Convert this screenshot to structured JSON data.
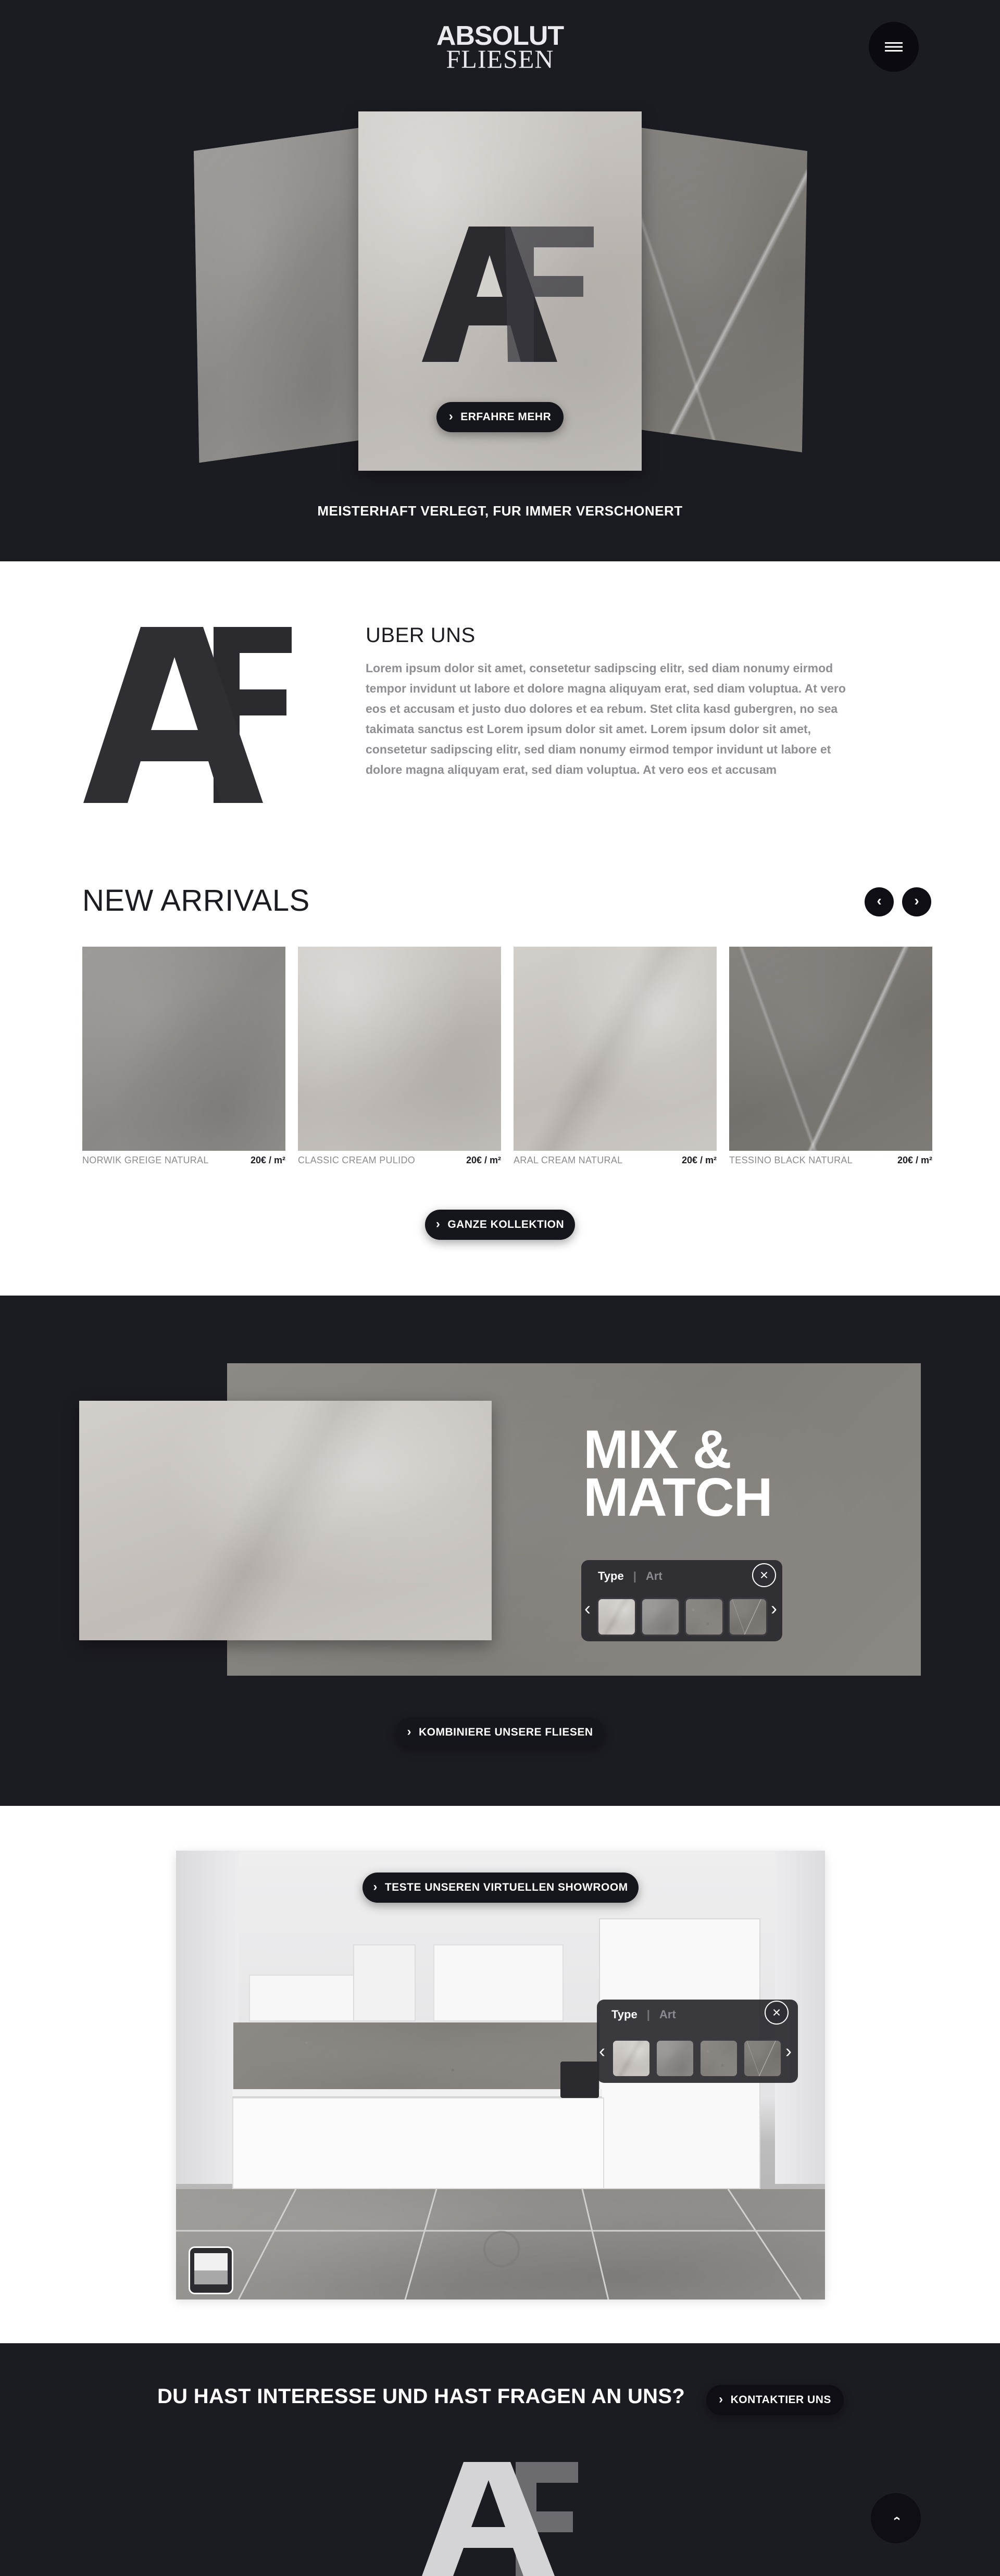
{
  "header": {
    "logo_line1": "ABSOLUT",
    "logo_line2": "FLIESEN",
    "menu_icon": "hamburger-icon"
  },
  "hero": {
    "cta_label": "ERFAHRE MEHR",
    "tagline": "MEISTERHAFT VERLEGT, FUR IMMER VERSCHONERT",
    "monogram_a": "A",
    "monogram_f": "F"
  },
  "about": {
    "title": "UBER UNS",
    "body": "Lorem ipsum dolor sit amet, consetetur sadipscing elitr, sed diam nonumy eirmod tempor invidunt ut labore et dolore magna aliquyam erat, sed diam voluptua. At vero eos et accusam et justo duo dolores et ea rebum. Stet clita kasd gubergren, no sea takimata sanctus est Lorem ipsum dolor sit amet. Lorem ipsum dolor sit amet, consetetur sadipscing elitr, sed diam nonumy eirmod tempor invidunt ut labore et dolore magna aliquyam erat, sed diam voluptua. At vero eos et accusam"
  },
  "arrivals": {
    "title": "NEW ARRIVALS",
    "prev_icon": "chevron-left-icon",
    "next_icon": "chevron-right-icon",
    "products": [
      {
        "name": "NORWIK GREIGE NATURAL",
        "price": "20€ / m²"
      },
      {
        "name": "CLASSIC CREAM PULIDO",
        "price": "20€ / m²"
      },
      {
        "name": "ARAL CREAM NATURAL",
        "price": "20€ / m²"
      },
      {
        "name": "TESSINO BLACK NATURAL",
        "price": "20€ / m²"
      }
    ],
    "cta_label": "GANZE KOLLEKTION"
  },
  "mix": {
    "title_line1": "MIX &",
    "title_line2": "MATCH",
    "tab_type": "Type",
    "tab_separator": "|",
    "tab_art": "Art",
    "cta_label": "KOMBINIERE UNSERE FLIESEN"
  },
  "showroom": {
    "cta_label": "TESTE UNSEREN VIRTUELLEN SHOWROOM",
    "tab_type": "Type",
    "tab_separator": "|",
    "tab_art": "Art"
  },
  "contact": {
    "question": "DU HAST INTERESSE UND HAST FRAGEN AN UNS?",
    "cta_label": "KONTAKTIER UNS",
    "scroll_top_icon": "chevron-up-icon"
  },
  "colors": {
    "dark_bg": "#1b1b22",
    "button_bg": "#15151c",
    "text_gray": "#8b8b90",
    "white": "#ffffff"
  }
}
